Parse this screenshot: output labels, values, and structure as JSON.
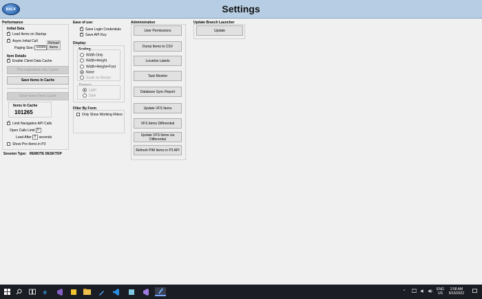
{
  "window": {
    "title": "Settings",
    "back_label": "BACK"
  },
  "performance": {
    "heading": "Performance",
    "initial_data": {
      "heading": "Initial Data",
      "load_on_startup": "Load Items on Startup",
      "async_initial": "Async Initial Call",
      "paging_label": "Paging Size:",
      "paging_value": "10000",
      "reload_button": "Reload Items"
    },
    "item_details": {
      "heading": "Item Details",
      "enable_cache": "Enable Client Data Cache",
      "preload_button": "Pre-Load Items Into Cache",
      "save_button": "Save Items In Cache",
      "clear_button": "Clear Items From Cache",
      "cache_heading": "Items In Cache",
      "cache_count": "101265"
    },
    "limit_api": "Limit Navigation API Calls",
    "open_calls_label": "Open Calls Limit",
    "open_calls_value": "0",
    "load_after_label": "Load After",
    "load_after_value": "3",
    "load_after_unit": "seconds",
    "show_preitems": "Show Pre-Items in P3",
    "session_label": "Session Type:",
    "session_value": "REMOTE DESKTOP"
  },
  "ease_of_use": {
    "heading": "Ease of use:",
    "save_login": "Save Login Credentials",
    "save_api": "Save API Key"
  },
  "display": {
    "heading": "Display:",
    "scaling": {
      "heading": "Scaling",
      "options": [
        "Width Only",
        "Width+Height",
        "Width+Height+Font",
        "None",
        "Scale on Resize"
      ]
    },
    "themes": {
      "heading": "Themes",
      "options": [
        "Light",
        "Dark"
      ]
    }
  },
  "filter": {
    "heading": "Filter By Form",
    "only_working": "Only Show Working Filters"
  },
  "administration": {
    "heading": "Administration",
    "buttons": [
      "User Permissions",
      "Dump Items to CSV",
      "Location Labels",
      "Task Monitor",
      "Database Sync Report",
      "Update VFS Items",
      "VFS Items Differential",
      "Update VFS Items via Differential",
      "Refresh PIM Items in P3 API"
    ]
  },
  "launcher": {
    "heading": "Update Branch Launcher",
    "update_button": "Update"
  },
  "taskbar": {
    "language": "ENG",
    "region": "US",
    "time": "2:58 AM",
    "date": "8/16/2022",
    "icons": [
      "windows-start-icon",
      "search-icon",
      "task-view-icon",
      "edge-icon",
      "visual-studio-icon",
      "sticky-icon",
      "file-explorer-icon",
      "pen-icon",
      "vs-code-icon",
      "files-icon",
      "visual-studio-2-icon",
      "app-active-icon"
    ]
  }
}
